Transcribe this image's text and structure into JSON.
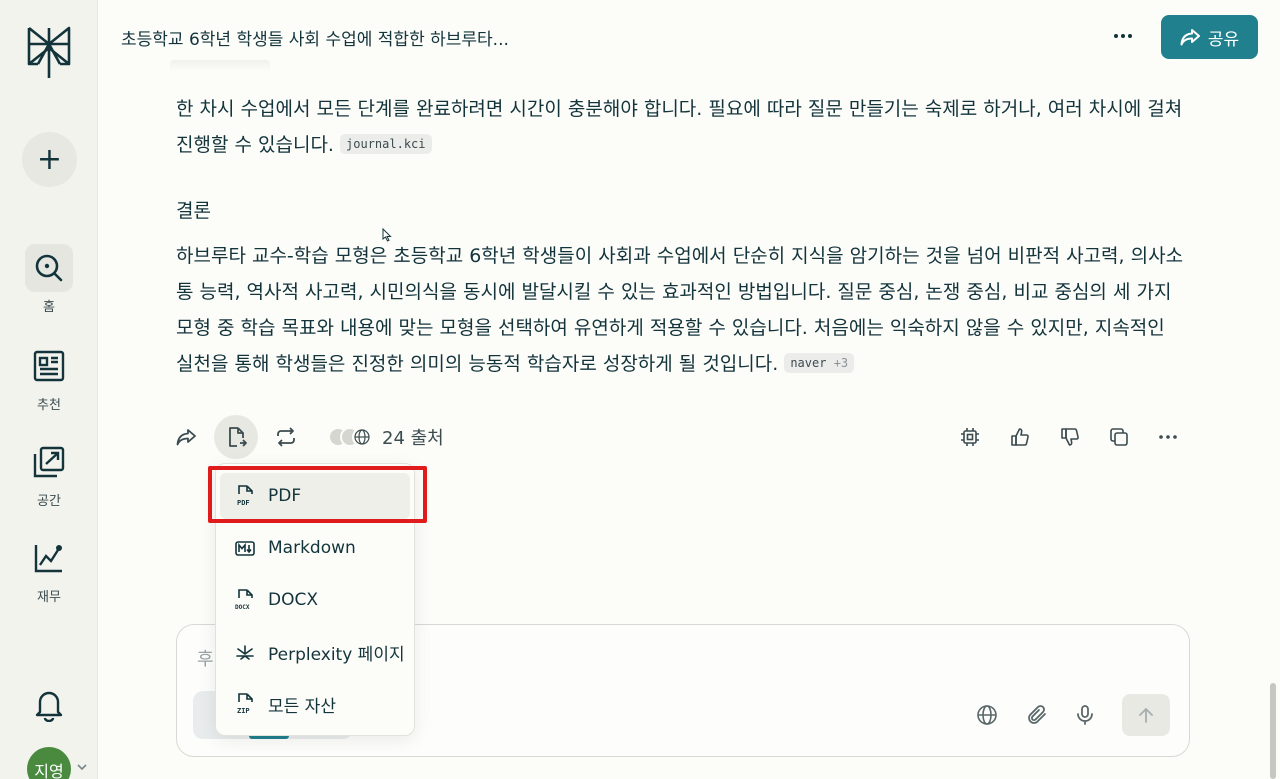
{
  "sidebar": {
    "new_label": "+",
    "items": [
      {
        "label": "홈",
        "icon": "search-home-icon"
      },
      {
        "label": "추천",
        "icon": "newspaper-icon"
      },
      {
        "label": "공간",
        "icon": "spaces-icon"
      },
      {
        "label": "재무",
        "icon": "finance-chart-icon"
      }
    ],
    "avatar_text": "지영"
  },
  "header": {
    "title": "초등학교 6학년 학생들 사회 수업에 적합한 하브루타...",
    "share_label": "공유"
  },
  "content": {
    "para1": "한 차시 수업에서 모든 단계를 완료하려면 시간이 충분해야 합니다. 필요에 따라 질문 만들기는 숙제로 하거나, 여러 차시에 걸쳐 진행할 수 있습니다.",
    "para1_chip": "journal.kci",
    "heading": "결론",
    "para2": "하브루타 교수-학습 모형은 초등학교 6학년 학생들이 사회과 수업에서 단순히 지식을 암기하는 것을 넘어 비판적 사고력, 의사소통 능력, 역사적 사고력, 시민의식을 동시에 발달시킬 수 있는 효과적인 방법입니다. 질문 중심, 논쟁 중심, 비교 중심의 세 가지 모형 중 학습 목표와 내용에 맞는 모형을 선택하여 유연하게 적용할 수 있습니다. 처음에는 익숙하지 않을 수 있지만, 지속적인 실천을 통해 학생들은 진정한 의미의 능동적 학습자로 성장하게 될 것입니다.",
    "para2_chip": "naver",
    "para2_chip_extra": "+3"
  },
  "actions": {
    "sources_label": "24 출처"
  },
  "export_menu": {
    "items": [
      {
        "label": "PDF",
        "icon": "pdf-file-icon"
      },
      {
        "label": "Markdown",
        "icon": "markdown-icon"
      },
      {
        "label": "DOCX",
        "icon": "docx-file-icon"
      },
      {
        "label": "Perplexity 페이지",
        "icon": "perplexity-page-icon"
      },
      {
        "label": "모든 자산",
        "icon": "zip-file-icon"
      }
    ]
  },
  "composer": {
    "placeholder": "후"
  },
  "colors": {
    "accent": "#20808d",
    "highlight_box": "#e01b1b",
    "avatar": "#4a8a3f"
  }
}
